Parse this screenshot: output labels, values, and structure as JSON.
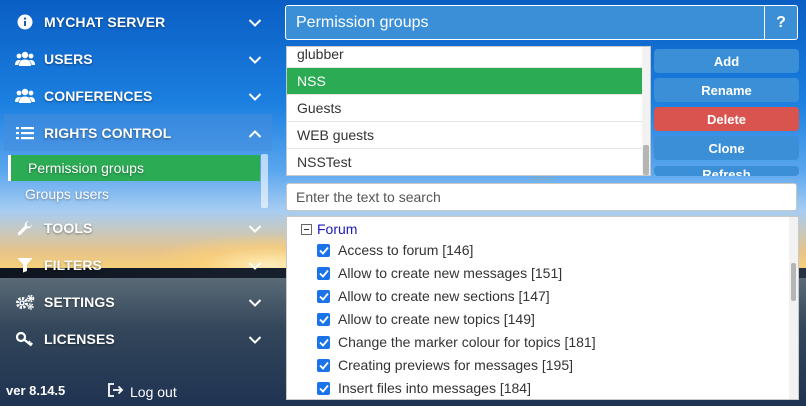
{
  "sidebar": {
    "items": [
      {
        "label": "MYCHAT SERVER",
        "icon": "info-icon"
      },
      {
        "label": "USERS",
        "icon": "users-icon"
      },
      {
        "label": "CONFERENCES",
        "icon": "conferences-icon"
      },
      {
        "label": "RIGHTS CONTROL",
        "icon": "list-icon"
      },
      {
        "label": "TOOLS",
        "icon": "wrench-icon"
      },
      {
        "label": "FILTERS",
        "icon": "filter-icon"
      },
      {
        "label": "SETTINGS",
        "icon": "gears-icon"
      },
      {
        "label": "LICENSES",
        "icon": "key-icon"
      }
    ],
    "subitems": [
      {
        "label": "Permission groups"
      },
      {
        "label": "Groups users"
      }
    ],
    "version": "ver 8.14.5",
    "logout": "Log out"
  },
  "header": {
    "title": "Permission groups",
    "help": "?"
  },
  "groups": [
    "glubber",
    "NSS",
    "Guests",
    "WEB guests",
    "NSSTest"
  ],
  "actions": {
    "add": "Add",
    "rename": "Rename",
    "delete": "Delete",
    "clone": "Clone",
    "refresh": "Refresh"
  },
  "search": {
    "placeholder": "Enter the text to search"
  },
  "permissions": {
    "section": "Forum",
    "items": [
      "Access to forum [146]",
      "Allow to create new messages [151]",
      "Allow to create new sections [147]",
      "Allow to create new topics [149]",
      "Change the marker colour for topics [181]",
      "Creating previews for messages [195]",
      "Insert files into messages [184]"
    ]
  },
  "colors": {
    "accent": "#3b8fd6",
    "selected": "#2cab55",
    "danger": "#d9534f",
    "checkbox": "#1a73e8"
  }
}
